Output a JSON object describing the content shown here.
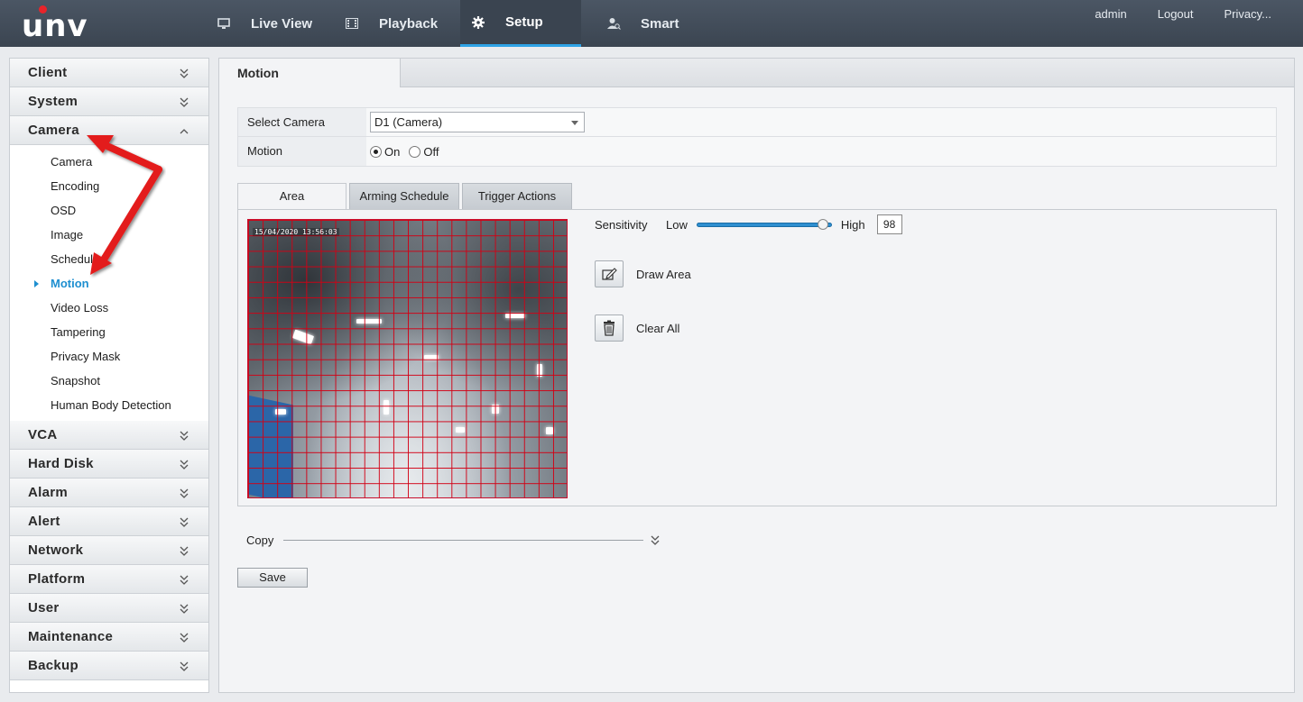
{
  "brand": {
    "logo": "unv"
  },
  "nav": {
    "items": [
      {
        "label": "Live View",
        "icon": "monitor-icon"
      },
      {
        "label": "Playback",
        "icon": "film-icon"
      },
      {
        "label": "Setup",
        "icon": "gear-icon",
        "active": true
      },
      {
        "label": "Smart",
        "icon": "person-search-icon"
      }
    ],
    "links": [
      "admin",
      "Logout",
      "Privacy..."
    ]
  },
  "sidebar": {
    "sections": [
      {
        "label": "Client"
      },
      {
        "label": "System"
      },
      {
        "label": "Camera",
        "expanded": true
      },
      {
        "label": "VCA"
      },
      {
        "label": "Hard Disk"
      },
      {
        "label": "Alarm"
      },
      {
        "label": "Alert"
      },
      {
        "label": "Network"
      },
      {
        "label": "Platform"
      },
      {
        "label": "User"
      },
      {
        "label": "Maintenance"
      },
      {
        "label": "Backup"
      }
    ],
    "camera_items": [
      "Camera",
      "Encoding",
      "OSD",
      "Image",
      "Schedule",
      "Motion",
      "Video Loss",
      "Tampering",
      "Privacy Mask",
      "Snapshot",
      "Human Body Detection"
    ],
    "active_item": "Motion"
  },
  "main": {
    "title": "Motion",
    "select_camera_label": "Select Camera",
    "select_camera_value": "D1 (Camera)",
    "motion_label": "Motion",
    "motion_on": "On",
    "motion_off": "Off",
    "motion_state": "On",
    "tabs": [
      "Area",
      "Arming Schedule",
      "Trigger Actions"
    ],
    "active_tab": "Area",
    "video_timestamp": "15/04/2020 13:56:03",
    "sensitivity_label": "Sensitivity",
    "low_label": "Low",
    "high_label": "High",
    "sensitivity_value": "98",
    "sensitivity_fraction": 0.98,
    "draw_area": "Draw Area",
    "clear_all": "Clear All",
    "copy_label": "Copy",
    "save_label": "Save"
  },
  "colors": {
    "topbar": "#414b57",
    "accent": "#2fa3e6",
    "active_link": "#1e8fd0",
    "grid": "#d00014",
    "annotation_arrow": "#e31b1b"
  }
}
